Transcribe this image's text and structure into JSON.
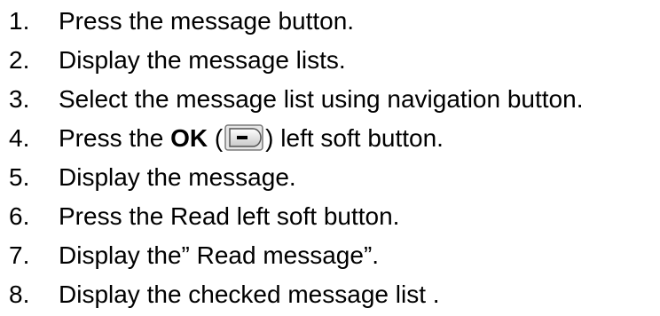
{
  "steps": [
    {
      "number": "1.",
      "text": "Press the message button."
    },
    {
      "number": "2.",
      "text": "Display the message lists."
    },
    {
      "number": "3.",
      "text": "Select the message list using navigation button."
    },
    {
      "number": "4.",
      "text_before": "Press the ",
      "bold": "OK",
      "paren_open": " (",
      "icon": "left-soft-key-icon",
      "paren_close": ")",
      "text_after": " left soft button."
    },
    {
      "number": "5.",
      "text": "Display the message."
    },
    {
      "number": "6.",
      "text": "Press the Read left soft button."
    },
    {
      "number": "7.",
      "text": "Display the” Read message”."
    },
    {
      "number": "8.",
      "text": "Display the checked message list ."
    }
  ]
}
